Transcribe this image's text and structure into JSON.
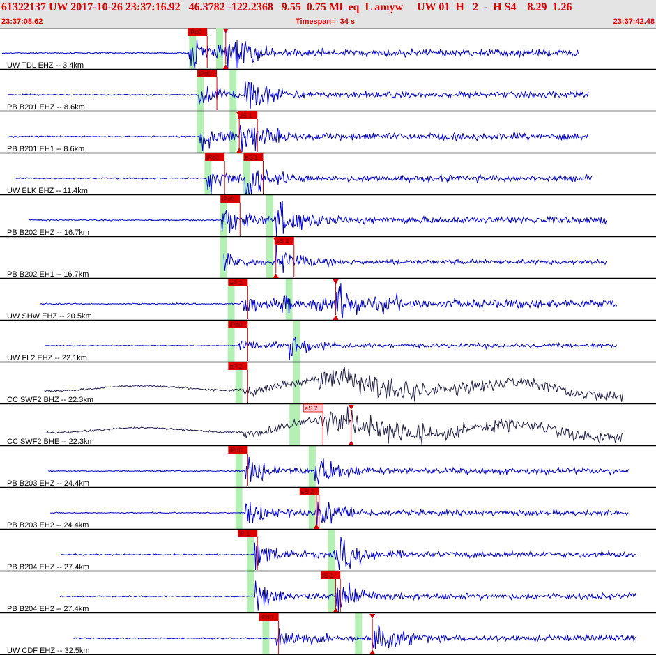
{
  "header": {
    "title": "61322137 UW 2017-10-26 23:37:16.92   46.3782 -122.2368   9.55  0.75 Ml  eq  L amyw     UW 01  H   2  -  H S4    8.29  1.26",
    "start_time": "23:37:08.62",
    "timespan": "Timespan=  34 s",
    "end_time": "23:37:42.48"
  },
  "colors": {
    "trace_blue": "#0000cc",
    "trace_dark": "#20204a",
    "pick_red": "#dd0000",
    "pick_pale": "#ffcccc",
    "window_green": "#b4f0b4",
    "header_red": "#e00000"
  },
  "chart_data": {
    "type": "line",
    "title": "61322137 UW 2017-10-26 23:37:16.92",
    "x_unit": "s",
    "x_range": [
      0,
      34
    ],
    "traces": [
      {
        "label": "UW TDL EHZ -- 3.4km",
        "color": "blue",
        "start": 0.1,
        "end": 30.0,
        "p": 9.8,
        "s": 11.7,
        "amp": 1.0,
        "wave": false,
        "picks": [
          {
            "label": "iPd0",
            "t": 9.8,
            "pale": false
          }
        ],
        "s_marker": 11.7,
        "green": [
          9.8,
          11.2
        ]
      },
      {
        "label": "PB B201 EHZ -- 8.6km",
        "color": "blue",
        "start": 0.4,
        "end": 30.5,
        "p": 10.3,
        "s": 12.7,
        "amp": 0.9,
        "wave": false,
        "picks": [
          {
            "label": "iPd0",
            "t": 10.3,
            "pale": false
          }
        ],
        "s_marker": null,
        "green": [
          10.2,
          11.9
        ]
      },
      {
        "label": "PB B201 EH1 -- 8.6km",
        "color": "blue",
        "start": 0.4,
        "end": 30.5,
        "p": 10.3,
        "s": 12.4,
        "amp": 1.0,
        "wave": false,
        "picks": [
          {
            "label": "eS 1",
            "t": 12.4,
            "pale": false
          }
        ],
        "s_marker": 12.4,
        "green": [
          10.2,
          11.9
        ]
      },
      {
        "label": "UW ELK EHZ -- 11.4km",
        "color": "blue",
        "start": 0.8,
        "end": 30.7,
        "p": 10.7,
        "s": 12.7,
        "amp": 0.9,
        "wave": false,
        "dc_step": true,
        "picks": [
          {
            "label": "iPc0",
            "t": 10.7,
            "pale": false
          },
          {
            "label": "eS 1",
            "t": 12.7,
            "pale": false
          }
        ],
        "s_marker": null,
        "green": [
          10.6,
          12.6
        ]
      },
      {
        "label": "PB B202 EHZ -- 16.7km",
        "color": "blue",
        "start": 1.5,
        "end": 31.5,
        "p": 11.5,
        "s": 14.3,
        "amp": 1.0,
        "wave": false,
        "picks": [
          {
            "label": "iPd0",
            "t": 11.5,
            "pale": false
          }
        ],
        "s_marker": null,
        "green": [
          11.4,
          13.8
        ]
      },
      {
        "label": "PB B202 EH1 -- 16.7km",
        "color": "blue",
        "start": 11.6,
        "end": 31.5,
        "p": 11.6,
        "s": 14.3,
        "amp": 0.7,
        "wave": false,
        "picks": [
          {
            "label": "eS 2",
            "t": 14.3,
            "pale": false
          }
        ],
        "s_marker": 14.3,
        "green": [
          11.4,
          13.8
        ]
      },
      {
        "label": "UW SHW EHZ -- 20.5km",
        "color": "blue",
        "start": 2.1,
        "end": 32.0,
        "p": 12.5,
        "s": 17.4,
        "amp": 1.0,
        "wave": false,
        "busy": true,
        "picks": [
          {
            "label": "eP 2",
            "t": 11.9,
            "pale": false
          }
        ],
        "s_marker": 17.4,
        "green": [
          11.8,
          14.8
        ]
      },
      {
        "label": "UW FL2 EHZ -- 22.1km",
        "color": "blue",
        "start": 2.3,
        "end": 32.0,
        "p": 12.4,
        "s": 15.0,
        "amp": 0.6,
        "wave": false,
        "picks": [
          {
            "label": "iPd0",
            "t": 11.9,
            "pale": false
          }
        ],
        "s_marker": null,
        "green": [
          11.8,
          15.2
        ]
      },
      {
        "label": "CC SWF2 BHZ -- 22.3km",
        "color": "dark",
        "start": 2.3,
        "end": 32.3,
        "p": 12.6,
        "s": 16.5,
        "amp": 1.0,
        "wave": true,
        "picks": [
          {
            "label": "eP 2",
            "t": 11.9,
            "pale": false
          }
        ],
        "s_marker": null,
        "green": [
          12.2,
          15.2
        ]
      },
      {
        "label": "CC SWF2 BHE -- 22.3km",
        "color": "dark",
        "start": 2.3,
        "end": 32.3,
        "p": 12.6,
        "s": 16.6,
        "amp": 1.0,
        "wave": true,
        "picks": [
          {
            "label": "eS 2",
            "t": 15.8,
            "pale": true
          }
        ],
        "s_marker": 18.2,
        "green": [
          15.0,
          15.2
        ]
      },
      {
        "label": "PB B203 EHZ -- 24.4km",
        "color": "blue",
        "start": 2.5,
        "end": 32.6,
        "p": 12.7,
        "s": 16.3,
        "amp": 0.9,
        "wave": false,
        "picks": [
          {
            "label": "iPd0",
            "t": 11.9,
            "pale": false
          }
        ],
        "s_marker": null,
        "green": [
          12.2,
          16.0
        ]
      },
      {
        "label": "PB B203 EH2 -- 24.4km",
        "color": "blue",
        "start": 2.6,
        "end": 32.6,
        "p": 12.7,
        "s": 16.4,
        "amp": 0.8,
        "wave": false,
        "picks": [
          {
            "label": "eS 2",
            "t": 15.6,
            "pale": false
          }
        ],
        "s_marker": 16.4,
        "green": [
          12.2,
          16.0
        ]
      },
      {
        "label": "PB B204 EHZ -- 27.4km",
        "color": "blue",
        "start": 3.1,
        "end": 33.0,
        "p": 13.2,
        "s": 17.4,
        "amp": 0.9,
        "wave": false,
        "picks": [
          {
            "label": "iP 1",
            "t": 12.4,
            "pale": false
          }
        ],
        "s_marker": null,
        "green": [
          12.8,
          17.0
        ]
      },
      {
        "label": "PB B204 EH2 -- 27.4km",
        "color": "blue",
        "start": 3.1,
        "end": 33.0,
        "p": 13.2,
        "s": 17.4,
        "amp": 0.9,
        "wave": false,
        "picks": [
          {
            "label": "iS 1",
            "t": 16.7,
            "pale": false
          }
        ],
        "s_marker": 17.4,
        "green": [
          12.8,
          17.0
        ]
      },
      {
        "label": "UW CDF EHZ -- 32.5km",
        "color": "blue",
        "start": 3.8,
        "end": 33.0,
        "p": 14.3,
        "s": 19.3,
        "amp": 0.9,
        "wave": false,
        "picks": [
          {
            "label": "iPd0",
            "t": 13.5,
            "pale": false
          }
        ],
        "s_marker": 19.3,
        "green": [
          13.6,
          18.4
        ]
      }
    ]
  }
}
